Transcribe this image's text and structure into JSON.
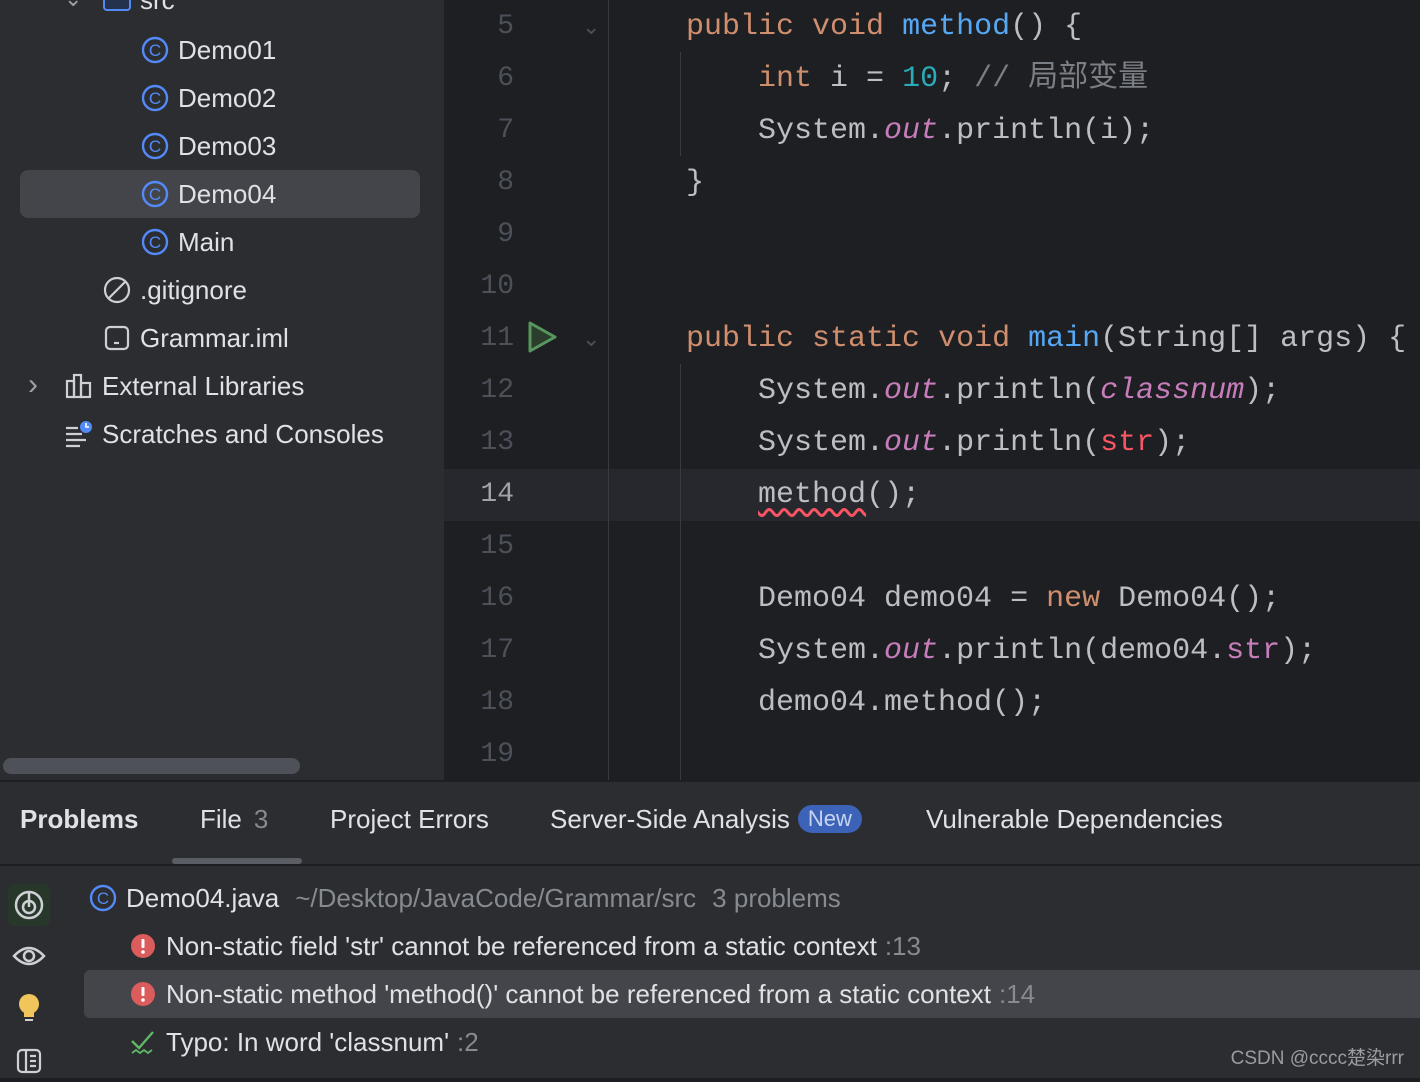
{
  "project_tree": {
    "src_label": "src",
    "items": [
      {
        "label": "Demo01",
        "icon": "class-icon"
      },
      {
        "label": "Demo02",
        "icon": "class-icon"
      },
      {
        "label": "Demo03",
        "icon": "class-icon"
      },
      {
        "label": "Demo04",
        "icon": "class-icon",
        "selected": true
      },
      {
        "label": "Main",
        "icon": "class-icon"
      },
      {
        "label": ".gitignore",
        "icon": "ignore-file-icon"
      },
      {
        "label": "Grammar.iml",
        "icon": "module-file-icon"
      },
      {
        "label": "External Libraries",
        "icon": "library-icon"
      },
      {
        "label": "Scratches and Consoles",
        "icon": "scratches-icon"
      }
    ]
  },
  "editor": {
    "current_line": "14",
    "lines": [
      {
        "n": "5",
        "tokens": [
          [
            "    ",
            ""
          ],
          [
            "public ",
            "kw"
          ],
          [
            "void ",
            "kw"
          ],
          [
            "method",
            "fn"
          ],
          [
            "() {",
            ""
          ]
        ]
      },
      {
        "n": "6",
        "tokens": [
          [
            "        ",
            ""
          ],
          [
            "int ",
            "kw"
          ],
          [
            "i = ",
            ""
          ],
          [
            "10",
            "num"
          ],
          [
            "; ",
            ""
          ],
          [
            "// 局部变量",
            "cm"
          ]
        ]
      },
      {
        "n": "7",
        "tokens": [
          [
            "        System.",
            ""
          ],
          [
            "out",
            "st"
          ],
          [
            ".println(i);",
            ""
          ]
        ]
      },
      {
        "n": "8",
        "tokens": [
          [
            "    }",
            ""
          ]
        ]
      },
      {
        "n": "9",
        "tokens": []
      },
      {
        "n": "10",
        "tokens": []
      },
      {
        "n": "11",
        "tokens": [
          [
            "    ",
            ""
          ],
          [
            "public ",
            "kw"
          ],
          [
            "static ",
            "kw"
          ],
          [
            "void ",
            "kw"
          ],
          [
            "main",
            "fn"
          ],
          [
            "(String[] args) {",
            ""
          ]
        ]
      },
      {
        "n": "12",
        "tokens": [
          [
            "        System.",
            ""
          ],
          [
            "out",
            "st"
          ],
          [
            ".println(",
            ""
          ],
          [
            "classnum",
            "ifld"
          ],
          [
            ");",
            ""
          ]
        ]
      },
      {
        "n": "13",
        "tokens": [
          [
            "        System.",
            ""
          ],
          [
            "out",
            "st"
          ],
          [
            ".println(",
            ""
          ],
          [
            "str",
            "red"
          ],
          [
            ");",
            ""
          ]
        ]
      },
      {
        "n": "14",
        "tokens": [
          [
            "        ",
            ""
          ],
          [
            "method",
            "err"
          ],
          [
            "();",
            ""
          ]
        ]
      },
      {
        "n": "15",
        "tokens": []
      },
      {
        "n": "16",
        "tokens": [
          [
            "        Demo04 demo04 = ",
            ""
          ],
          [
            "new ",
            "kw"
          ],
          [
            "Demo04();",
            ""
          ]
        ]
      },
      {
        "n": "17",
        "tokens": [
          [
            "        System.",
            ""
          ],
          [
            "out",
            "st"
          ],
          [
            ".println(demo04.",
            ""
          ],
          [
            "str",
            "fld"
          ],
          [
            ");",
            ""
          ]
        ]
      },
      {
        "n": "18",
        "tokens": [
          [
            "        demo04.method();",
            ""
          ]
        ]
      },
      {
        "n": "19",
        "tokens": []
      }
    ]
  },
  "problems": {
    "tabs": [
      {
        "label": "Problems"
      },
      {
        "label": "File",
        "count": "3"
      },
      {
        "label": "Project Errors"
      },
      {
        "label": "Server-Side Analysis",
        "badge": "New"
      },
      {
        "label": "Vulnerable Dependencies"
      }
    ],
    "file": {
      "name": "Demo04.java",
      "path": "~/Desktop/JavaCode/Grammar/src",
      "summary": "3 problems"
    },
    "items": [
      {
        "text": "Non-static field 'str' cannot be referenced from a static context",
        "line": ":13",
        "severity": "error"
      },
      {
        "text": "Non-static method 'method()' cannot be referenced from a static context",
        "line": ":14",
        "severity": "error",
        "selected": true
      },
      {
        "text": "Typo: In word 'classnum'",
        "line": ":2",
        "severity": "typo"
      }
    ]
  },
  "colors": {
    "error": "#db5c5c",
    "accent": "#548af7",
    "run": "#57965c",
    "badge": "#3d63b8"
  },
  "watermark": "CSDN @cccc楚染rrr"
}
